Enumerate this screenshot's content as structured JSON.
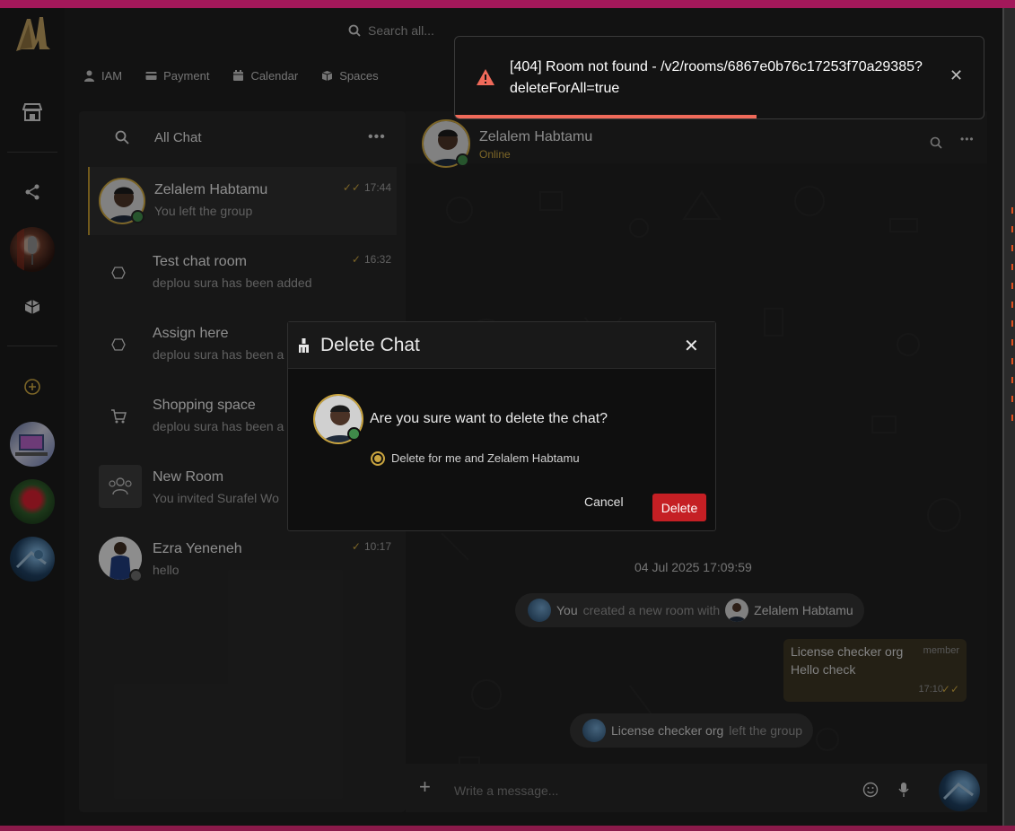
{
  "header": {
    "search_placeholder": "Search all...",
    "nav": [
      {
        "label": "IAM",
        "icon": "user-icon"
      },
      {
        "label": "Payment",
        "icon": "card-icon"
      },
      {
        "label": "Calendar",
        "icon": "calendar-icon"
      },
      {
        "label": "Spaces",
        "icon": "spaces-icon"
      }
    ]
  },
  "sidebar": {
    "icons": [
      "store-icon",
      "share-icon",
      "puzzle-icon",
      "add-circle-icon"
    ]
  },
  "chat_list": {
    "title": "All Chat",
    "items": [
      {
        "name": "Zelalem Habtamu",
        "message": "You left the group",
        "time": "17:44",
        "tick": "double",
        "status": "online",
        "active": true
      },
      {
        "name": "Test chat room",
        "message": "deplou sura has been added",
        "time": "16:32",
        "tick": "single"
      },
      {
        "name": "Assign here",
        "message": "deplou sura has been a",
        "time": ""
      },
      {
        "name": "Shopping space",
        "message": "deplou sura has been a",
        "time": ""
      },
      {
        "name": "New Room",
        "message": "You invited Surafel Wo",
        "time": ""
      },
      {
        "name": "Ezra Yeneneh",
        "message": "hello",
        "time": "10:17",
        "tick": "single",
        "status": "offline"
      }
    ]
  },
  "conversation": {
    "name": "Zelalem Habtamu",
    "status": "Online",
    "date": "04 Jul 2025 17:09:59",
    "system1": {
      "actor": "You",
      "text": "created a new room with",
      "target": "Zelalem Habtamu"
    },
    "bubble": {
      "from": "License checker org",
      "role": "member",
      "text": "Hello check",
      "time": "17:10"
    },
    "system2": {
      "actor": "License checker org",
      "text": "left the group"
    },
    "composer_placeholder": "Write a message..."
  },
  "modal": {
    "title": "Delete Chat",
    "question": "Are you sure want to delete the chat?",
    "option": "Delete for me and Zelalem Habtamu",
    "cancel": "Cancel",
    "delete": "Delete"
  },
  "toast": {
    "message": "[404] Room not found - /v2/rooms/6867e0b76c17253f70a29385?deleteForAll=true",
    "progress": 0.57
  },
  "colors": {
    "accent": "#c9a43f",
    "danger": "#c51f24",
    "toast_accent": "#f06a5a",
    "online": "#3f8a4a"
  }
}
